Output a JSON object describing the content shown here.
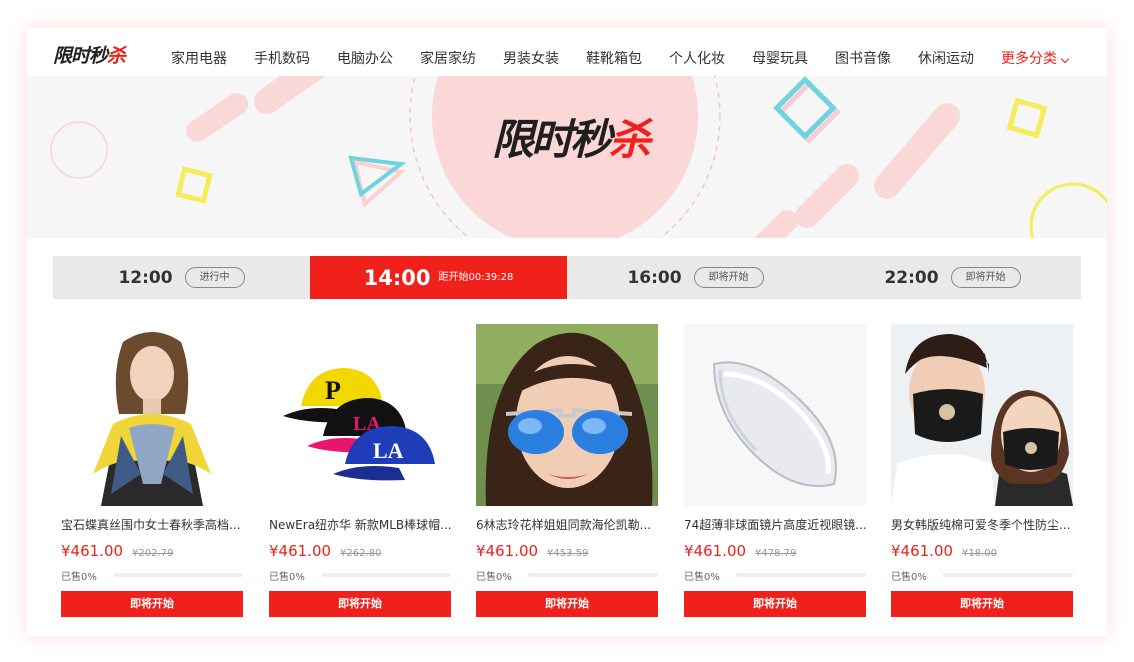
{
  "logo": {
    "text_a": "限时秒",
    "text_b": "杀"
  },
  "nav": {
    "items": [
      "家用电器",
      "手机数码",
      "电脑办公",
      "家居家纺",
      "男装女装",
      "鞋靴箱包",
      "个人化妆",
      "母婴玩具",
      "图书音像",
      "休闲运动"
    ],
    "more_label": "更多分类"
  },
  "banner": {
    "title_a": "限时秒",
    "title_b": "杀"
  },
  "timeslots": [
    {
      "time": "12:00",
      "status": "进行中",
      "active": false
    },
    {
      "time": "14:00",
      "status": "距开始00:39:28",
      "active": true
    },
    {
      "time": "16:00",
      "status": "即将开始",
      "active": false
    },
    {
      "time": "22:00",
      "status": "即将开始",
      "active": false
    }
  ],
  "products": [
    {
      "title": "宝石蝶真丝围巾女士春秋季高档...",
      "price": "¥461.00",
      "original_price": "¥202.79",
      "sold": "已售0%",
      "sold_fraction": 0,
      "button": "即将开始",
      "image": "scarf-model"
    },
    {
      "title": "NewEra纽亦华 新款MLB棒球帽...",
      "price": "¥461.00",
      "original_price": "¥262.80",
      "sold": "已售0%",
      "sold_fraction": 0,
      "button": "即将开始",
      "image": "baseball-caps"
    },
    {
      "title": "6林志玲花样姐姐同款海伦凯勒...",
      "price": "¥461.00",
      "original_price": "¥453.59",
      "sold": "已售0%",
      "sold_fraction": 0,
      "button": "即将开始",
      "image": "sunglasses-model"
    },
    {
      "title": "74超薄非球面镜片高度近视眼镜...",
      "price": "¥461.00",
      "original_price": "¥478.79",
      "sold": "已售0%",
      "sold_fraction": 0,
      "button": "即将开始",
      "image": "lens"
    },
    {
      "title": "男女韩版纯棉可爱冬季个性防尘...",
      "price": "¥461.00",
      "original_price": "¥18.00",
      "sold": "已售0%",
      "sold_fraction": 0,
      "button": "即将开始",
      "image": "face-masks"
    }
  ],
  "colors": {
    "accent": "#f0201a",
    "banner_bg": "#f6f6f6",
    "timebar_bg": "#e9e9e9"
  }
}
